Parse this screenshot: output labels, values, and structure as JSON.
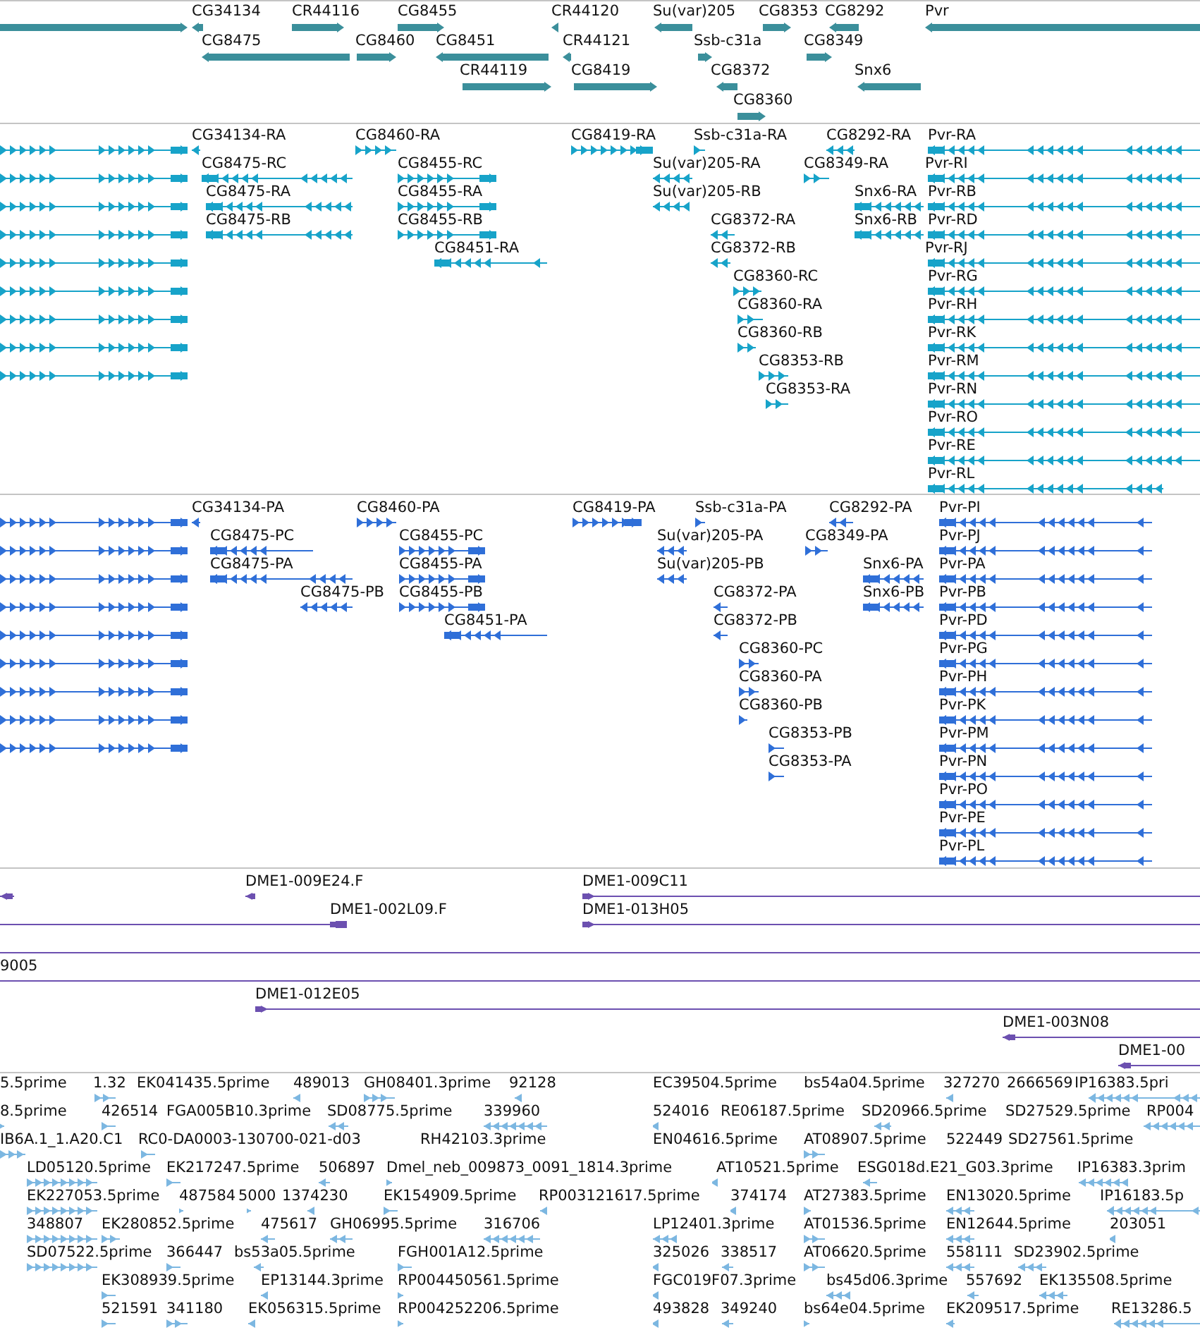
{
  "tracks": [
    {
      "kind": "genes",
      "rows": [
        {
          "features": [
            {
              "reverse": false
            },
            {
              "label": "CG34134",
              "reverse": true
            },
            {
              "label": "CR44116",
              "reverse": false
            },
            {
              "label": "CG8455",
              "reverse": false
            },
            {
              "label": "CR44120",
              "reverse": true
            },
            {
              "label": "Su(var)205",
              "reverse": true
            },
            {
              "label": "CG8353",
              "reverse": false
            },
            {
              "label": "CG8292",
              "reverse": true
            },
            {
              "label": "Pvr",
              "reverse": true
            }
          ]
        },
        {
          "features": [
            {
              "label": "CG8475",
              "reverse": true
            },
            {
              "label": "CG8460",
              "reverse": false
            },
            {
              "label": "CG8451",
              "reverse": true
            },
            {
              "label": "CR44121",
              "reverse": true
            },
            {
              "label": "Ssb-c31a",
              "reverse": false
            },
            {
              "label": "CG8349",
              "reverse": false
            }
          ]
        },
        {
          "features": [
            {
              "label": "CR44119",
              "reverse": false
            },
            {
              "label": "CG8419",
              "reverse": false
            },
            {
              "label": "CG8372",
              "reverse": true
            },
            {
              "label": "Snx6",
              "reverse": true
            }
          ]
        },
        {
          "features": [
            {
              "label": "CG8360",
              "reverse": false
            }
          ]
        }
      ]
    },
    {
      "kind": "transcripts",
      "rows": [
        {
          "features": [
            {
              "reverse": false
            },
            {
              "label": "CG34134-RA",
              "reverse": true
            },
            {
              "label": "CG8460-RA",
              "reverse": false
            },
            {
              "label": "CG8419-RA",
              "reverse": false
            },
            {
              "label": "Ssb-c31a-RA",
              "reverse": false
            },
            {
              "label": "CG8292-RA",
              "reverse": true
            },
            {
              "label": "Pvr-RA",
              "reverse": true
            }
          ]
        },
        {
          "features": [
            {
              "reverse": false
            },
            {
              "label": "CG8475-RC",
              "reverse": true
            },
            {
              "label": "CG8455-RC",
              "reverse": false
            },
            {
              "label": "Su(var)205-RA",
              "reverse": true
            },
            {
              "label": "CG8349-RA",
              "reverse": false
            },
            {
              "label": "Pvr-RI",
              "reverse": true
            }
          ]
        },
        {
          "features": [
            {
              "reverse": false
            },
            {
              "label": "CG8475-RA",
              "reverse": true
            },
            {
              "label": "CG8455-RA",
              "reverse": false
            },
            {
              "label": "Su(var)205-RB",
              "reverse": true
            },
            {
              "label": "Snx6-RA",
              "reverse": true
            },
            {
              "label": "Pvr-RB",
              "reverse": true
            }
          ]
        },
        {
          "features": [
            {
              "reverse": false
            },
            {
              "label": "CG8475-RB",
              "reverse": true
            },
            {
              "label": "CG8455-RB",
              "reverse": false
            },
            {
              "label": "CG8372-RA",
              "reverse": true
            },
            {
              "label": "Snx6-RB",
              "reverse": true
            },
            {
              "label": "Pvr-RD",
              "reverse": true
            }
          ]
        },
        {
          "features": [
            {
              "reverse": false
            },
            {
              "label": "CG8451-RA",
              "reverse": true
            },
            {
              "label": "CG8372-RB",
              "reverse": true
            },
            {
              "label": "Pvr-RJ",
              "reverse": true
            }
          ]
        },
        {
          "features": [
            {
              "reverse": false
            },
            {
              "label": "CG8360-RC",
              "reverse": false
            },
            {
              "label": "Pvr-RG",
              "reverse": true
            }
          ]
        },
        {
          "features": [
            {
              "reverse": false
            },
            {
              "label": "CG8360-RA",
              "reverse": false
            },
            {
              "label": "Pvr-RH",
              "reverse": true
            }
          ]
        },
        {
          "features": [
            {
              "reverse": false
            },
            {
              "label": "CG8360-RB",
              "reverse": false
            },
            {
              "label": "Pvr-RK",
              "reverse": true
            }
          ]
        },
        {
          "features": [
            {
              "reverse": false
            },
            {
              "label": "CG8353-RB",
              "reverse": false
            },
            {
              "label": "Pvr-RM",
              "reverse": true
            }
          ]
        },
        {
          "features": [
            {
              "label": "CG8353-RA",
              "reverse": false
            },
            {
              "label": "Pvr-RN",
              "reverse": true
            }
          ]
        },
        {
          "features": [
            {
              "label": "Pvr-RO",
              "reverse": true
            }
          ]
        },
        {
          "features": [
            {
              "label": "Pvr-RE",
              "reverse": true
            }
          ]
        },
        {
          "features": [
            {
              "label": "Pvr-RL",
              "reverse": true
            }
          ]
        }
      ]
    },
    {
      "kind": "proteins",
      "rows": [
        {
          "features": [
            {
              "reverse": false
            },
            {
              "label": "CG34134-PA",
              "reverse": true
            },
            {
              "label": "CG8460-PA",
              "reverse": false
            },
            {
              "label": "CG8419-PA",
              "reverse": false
            },
            {
              "label": "Ssb-c31a-PA",
              "reverse": false
            },
            {
              "label": "CG8292-PA",
              "reverse": true
            },
            {
              "label": "Pvr-PI",
              "reverse": true
            }
          ]
        },
        {
          "features": [
            {
              "reverse": false
            },
            {
              "label": "CG8475-PC",
              "reverse": true
            },
            {
              "label": "CG8455-PC",
              "reverse": false
            },
            {
              "label": "Su(var)205-PA",
              "reverse": true
            },
            {
              "label": "CG8349-PA",
              "reverse": false
            },
            {
              "label": "Pvr-PJ",
              "reverse": true
            }
          ]
        },
        {
          "features": [
            {
              "reverse": false
            },
            {
              "label": "CG8475-PA",
              "reverse": true
            },
            {
              "label": "CG8455-PA",
              "reverse": false
            },
            {
              "label": "Su(var)205-PB",
              "reverse": true
            },
            {
              "label": "Snx6-PA",
              "reverse": true
            },
            {
              "label": "Pvr-PA",
              "reverse": true
            }
          ]
        },
        {
          "features": [
            {
              "reverse": false
            },
            {
              "label": "CG8475-PB",
              "reverse": true
            },
            {
              "label": "CG8455-PB",
              "reverse": false
            },
            {
              "label": "CG8372-PA",
              "reverse": true
            },
            {
              "label": "Snx6-PB",
              "reverse": true
            },
            {
              "label": "Pvr-PB",
              "reverse": true
            }
          ]
        },
        {
          "features": [
            {
              "reverse": false
            },
            {
              "label": "CG8451-PA",
              "reverse": true
            },
            {
              "label": "CG8372-PB",
              "reverse": true
            },
            {
              "label": "Pvr-PD",
              "reverse": true
            }
          ]
        },
        {
          "features": [
            {
              "reverse": false
            },
            {
              "label": "CG8360-PC",
              "reverse": false
            },
            {
              "label": "Pvr-PG",
              "reverse": true
            }
          ]
        },
        {
          "features": [
            {
              "reverse": false
            },
            {
              "label": "CG8360-PA",
              "reverse": false
            },
            {
              "label": "Pvr-PH",
              "reverse": true
            }
          ]
        },
        {
          "features": [
            {
              "reverse": false
            },
            {
              "label": "CG8360-PB",
              "reverse": false
            },
            {
              "label": "Pvr-PK",
              "reverse": true
            }
          ]
        },
        {
          "features": [
            {
              "reverse": false
            },
            {
              "label": "CG8353-PB",
              "reverse": false
            },
            {
              "label": "Pvr-PM",
              "reverse": true
            }
          ]
        },
        {
          "features": [
            {
              "label": "CG8353-PA",
              "reverse": false
            },
            {
              "label": "Pvr-PN",
              "reverse": true
            }
          ]
        },
        {
          "features": [
            {
              "label": "Pvr-PO",
              "reverse": true
            }
          ]
        },
        {
          "features": [
            {
              "label": "Pvr-PE",
              "reverse": true
            }
          ]
        },
        {
          "features": [
            {
              "label": "Pvr-PL",
              "reverse": true
            }
          ]
        }
      ]
    },
    {
      "kind": "clones",
      "rows": [
        {
          "features": [
            {
              "reverse": true
            },
            {
              "label": "DME1-009E24.F",
              "reverse": true
            },
            {
              "label": "DME1-009C11",
              "reverse": false
            }
          ]
        },
        {
          "features": [
            {
              "label": "DME1-002L09.F",
              "reverse": false
            },
            {
              "label": "DME1-013H05",
              "reverse": false
            }
          ]
        },
        {
          "features": [
            {
              "kind": "line"
            }
          ]
        },
        {
          "features": [
            {
              "label": "9005",
              "kind": "line"
            }
          ]
        },
        {
          "features": [
            {
              "label": "DME1-012E05",
              "reverse": false
            }
          ]
        },
        {
          "features": [
            {
              "label": "DME1-003N08",
              "reverse": true
            }
          ]
        },
        {
          "features": [
            {
              "label": "DME1-00",
              "reverse": true
            }
          ]
        }
      ]
    },
    {
      "kind": "ests",
      "rows": [
        {
          "features": [
            {
              "label": "5.5prime"
            },
            {
              "label": "1.32",
              "reverse": false
            },
            {
              "label": "EK041435.5prime"
            },
            {
              "label": "489013",
              "reverse": true
            },
            {
              "label": "GH08401.3prime",
              "reverse": false
            },
            {
              "label": "92128",
              "reverse": true
            },
            {
              "label": "EC39504.5prime"
            },
            {
              "label": "bs54a04.5prime"
            },
            {
              "label": "327270",
              "reverse": true
            },
            {
              "label": "2666569"
            },
            {
              "label": "IP16383.5pri",
              "reverse": true
            }
          ]
        },
        {
          "features": [
            {
              "label": "8.5prime",
              "reverse": false
            },
            {
              "label": "426514",
              "reverse": false
            },
            {
              "label": "FGA005B10.3prime"
            },
            {
              "label": "SD08775.5prime",
              "reverse": true
            },
            {
              "label": "339960",
              "reverse": true
            },
            {
              "label": "524016",
              "reverse": true
            },
            {
              "label": "RE06187.5prime"
            },
            {
              "label": "SD20966.5prime",
              "reverse": true
            },
            {
              "label": "SD27529.5prime"
            },
            {
              "label": "RP004",
              "reverse": true
            }
          ]
        },
        {
          "features": [
            {
              "label": "IB6A.1_1.A20.C1",
              "reverse": false
            },
            {
              "label": "RC0-DA0003-130700-021-d03",
              "reverse": false
            },
            {
              "label": "RH42103.3prime"
            },
            {
              "label": "EN04616.5prime"
            },
            {
              "label": "AT08907.5prime",
              "reverse": false
            },
            {
              "label": "522449"
            },
            {
              "label": "SD27561.5prime"
            }
          ]
        },
        {
          "features": [
            {
              "label": "LD05120.5prime",
              "reverse": false
            },
            {
              "label": "EK217247.5prime",
              "reverse": false
            },
            {
              "label": "506897",
              "reverse": true
            },
            {
              "label": "Dmel_neb_009873_0091_1814.3prime",
              "reverse": false
            },
            {
              "label": "AT10521.5prime",
              "reverse": true
            },
            {
              "label": "ESG018d.E21_G03.3prime",
              "reverse": true
            },
            {
              "label": "IP16383.3prim",
              "reverse": true
            }
          ]
        },
        {
          "features": [
            {
              "label": "EK227053.5prime",
              "reverse": false
            },
            {
              "label": "487584",
              "reverse": false
            },
            {
              "label": "5000",
              "reverse": false
            },
            {
              "label": "1374230",
              "reverse": true
            },
            {
              "label": "EK154909.5prime",
              "reverse": false
            },
            {
              "label": "RP003121617.5prime",
              "reverse": true
            },
            {
              "label": "374174",
              "reverse": true
            },
            {
              "label": "AT27383.5prime",
              "reverse": false
            },
            {
              "label": "EN13020.5prime",
              "reverse": true
            },
            {
              "label": "IP16183.5p",
              "reverse": true
            }
          ]
        },
        {
          "features": [
            {
              "label": "348807",
              "reverse": false
            },
            {
              "label": "EK280852.5prime",
              "reverse": false
            },
            {
              "label": "475617",
              "reverse": true
            },
            {
              "label": "GH06995.5prime",
              "reverse": true
            },
            {
              "label": "316706",
              "reverse": true
            },
            {
              "label": "LP12401.3prime",
              "reverse": true
            },
            {
              "label": "AT01536.5prime",
              "reverse": false
            },
            {
              "label": "EN12644.5prime",
              "reverse": true
            },
            {
              "label": "203051",
              "reverse": true
            }
          ]
        },
        {
          "features": [
            {
              "label": "SD07522.5prime",
              "reverse": false
            },
            {
              "label": "366447",
              "reverse": false
            },
            {
              "label": "bs53a05.5prime",
              "reverse": true
            },
            {
              "label": "FGH001A12.5prime",
              "reverse": false
            },
            {
              "label": "325026",
              "reverse": true
            },
            {
              "label": "338517",
              "reverse": true
            },
            {
              "label": "AT06620.5prime",
              "reverse": false
            },
            {
              "label": "558111",
              "reverse": true
            },
            {
              "label": "SD23902.5prime",
              "reverse": true
            }
          ]
        },
        {
          "features": [
            {
              "label": "EK308939.5prime",
              "reverse": false
            },
            {
              "label": "EP13144.3prime",
              "reverse": true
            },
            {
              "label": "RP004450561.5prime",
              "reverse": false
            },
            {
              "label": "FGC019F07.3prime",
              "reverse": true
            },
            {
              "label": "bs45d06.3prime",
              "reverse": true
            },
            {
              "label": "557692",
              "reverse": true
            },
            {
              "label": "EK135508.5prime",
              "reverse": true
            }
          ]
        },
        {
          "features": [
            {
              "label": "521591",
              "reverse": false
            },
            {
              "label": "341180",
              "reverse": false
            },
            {
              "label": "EK056315.5prime",
              "reverse": true
            },
            {
              "label": "RP004252206.5prime",
              "reverse": false
            },
            {
              "label": "493828",
              "reverse": true
            },
            {
              "label": "349240",
              "reverse": true
            },
            {
              "label": "bs64e04.5prime",
              "reverse": false
            },
            {
              "label": "EK209517.5prime",
              "reverse": true
            },
            {
              "label": "RE13286.5",
              "reverse": true
            }
          ]
        }
      ]
    }
  ]
}
